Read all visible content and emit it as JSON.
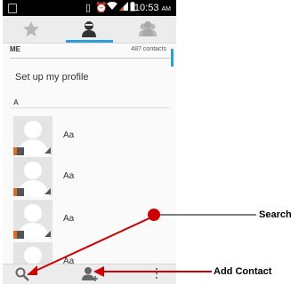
{
  "status_bar": {
    "time": "10:53",
    "ampm": "AM"
  },
  "tabs": [
    {
      "name": "favorites",
      "icon": "star-icon"
    },
    {
      "name": "contacts",
      "icon": "person-icon",
      "selected": true
    },
    {
      "name": "groups",
      "icon": "group-icon"
    }
  ],
  "me_section": {
    "label": "ME",
    "count": "487 contacts",
    "profile_text": "Set up my profile"
  },
  "section_a": "A",
  "contacts": [
    {
      "name": "Aa"
    },
    {
      "name": "Aa"
    },
    {
      "name": "Aa"
    },
    {
      "name": "Aa"
    }
  ],
  "bottom_bar": {
    "icons": [
      "search-icon",
      "add-contact-icon",
      "overflow-menu-icon"
    ]
  },
  "annotations": {
    "search": "Search",
    "add_contact": "Add Contact"
  },
  "colors": {
    "accent": "#2c9fd6",
    "annotation_arrow": "#cc0000",
    "status_bar": "#000000"
  }
}
